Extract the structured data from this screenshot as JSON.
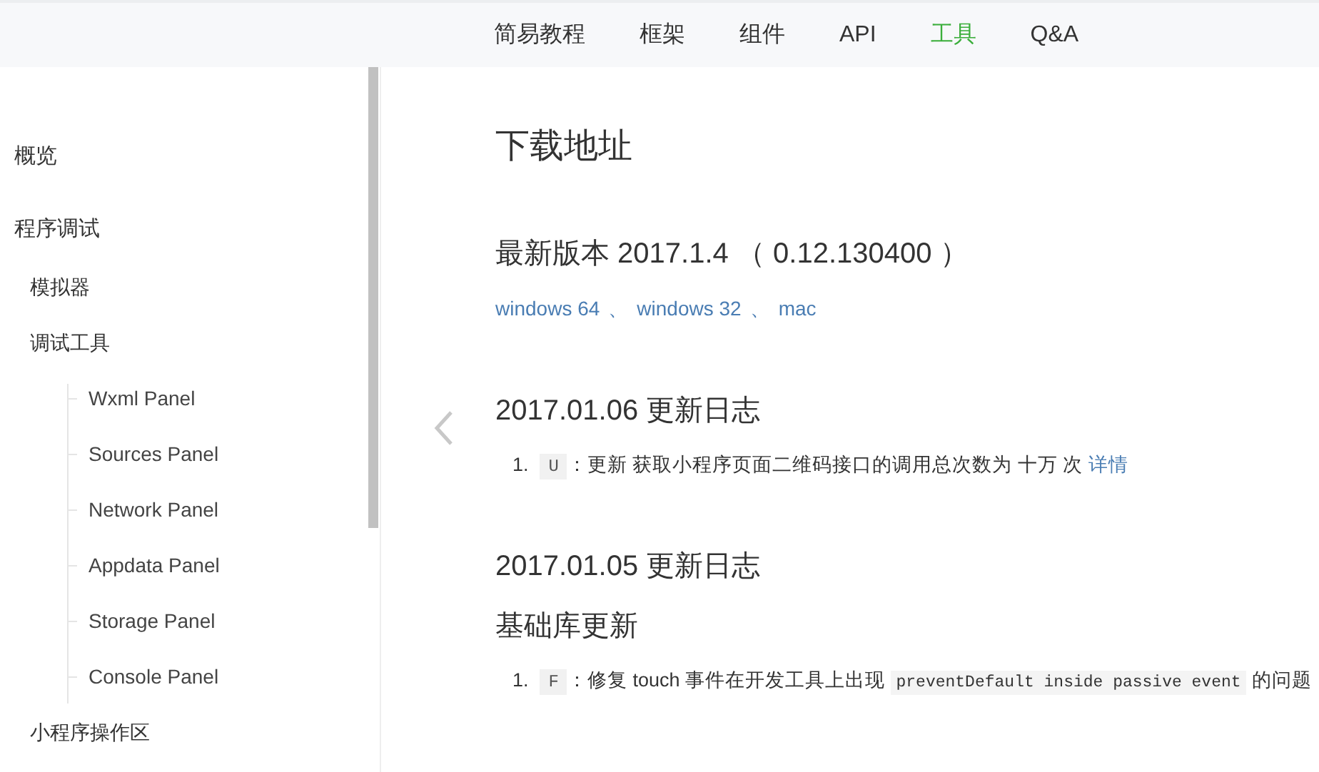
{
  "nav": {
    "items": [
      {
        "label": "简易教程",
        "selected": false
      },
      {
        "label": "框架",
        "selected": false
      },
      {
        "label": "组件",
        "selected": false
      },
      {
        "label": "API",
        "selected": false
      },
      {
        "label": "工具",
        "selected": true
      },
      {
        "label": "Q&A",
        "selected": false
      }
    ]
  },
  "sidebar": {
    "items": [
      {
        "label": "概览"
      },
      {
        "label": "程序调试",
        "children": [
          {
            "label": "模拟器"
          },
          {
            "label": "调试工具",
            "children": [
              {
                "label": "Wxml Panel"
              },
              {
                "label": "Sources Panel"
              },
              {
                "label": "Network Panel"
              },
              {
                "label": "Appdata Panel"
              },
              {
                "label": "Storage Panel"
              },
              {
                "label": "Console Panel"
              }
            ]
          },
          {
            "label": "小程序操作区"
          }
        ]
      }
    ]
  },
  "content": {
    "blocks": [
      {
        "kind": "title",
        "text": "下载地址"
      },
      {
        "kind": "heading",
        "text": "最新版本 2017.1.4 （ 0.12.130400 ）"
      },
      {
        "kind": "links",
        "items": [
          {
            "text": "windows 64",
            "separator": "、"
          },
          {
            "text": "windows 32",
            "separator": "、"
          },
          {
            "text": "mac"
          }
        ]
      },
      {
        "kind": "heading",
        "text": "2017.01.06 更新日志"
      },
      {
        "kind": "list",
        "items": [
          {
            "number": "1.",
            "segments": [
              {
                "kind": "tag",
                "text": "U"
              },
              {
                "kind": "text",
                "text": "：更新 获取小程序页面二维码接口的调用总次数为 十万 次 "
              },
              {
                "kind": "link",
                "text": "详情"
              }
            ]
          }
        ]
      },
      {
        "kind": "heading",
        "text": "2017.01.05 更新日志"
      },
      {
        "kind": "heading",
        "text": "基础库更新"
      },
      {
        "kind": "list",
        "items": [
          {
            "number": "1.",
            "segments": [
              {
                "kind": "tag",
                "text": "F"
              },
              {
                "kind": "text",
                "text": "：修复 touch 事件在开发工具上出现 "
              },
              {
                "kind": "code",
                "text": "preventDefault inside passive event"
              },
              {
                "kind": "text",
                "text": " 的问题"
              }
            ]
          }
        ]
      }
    ]
  }
}
